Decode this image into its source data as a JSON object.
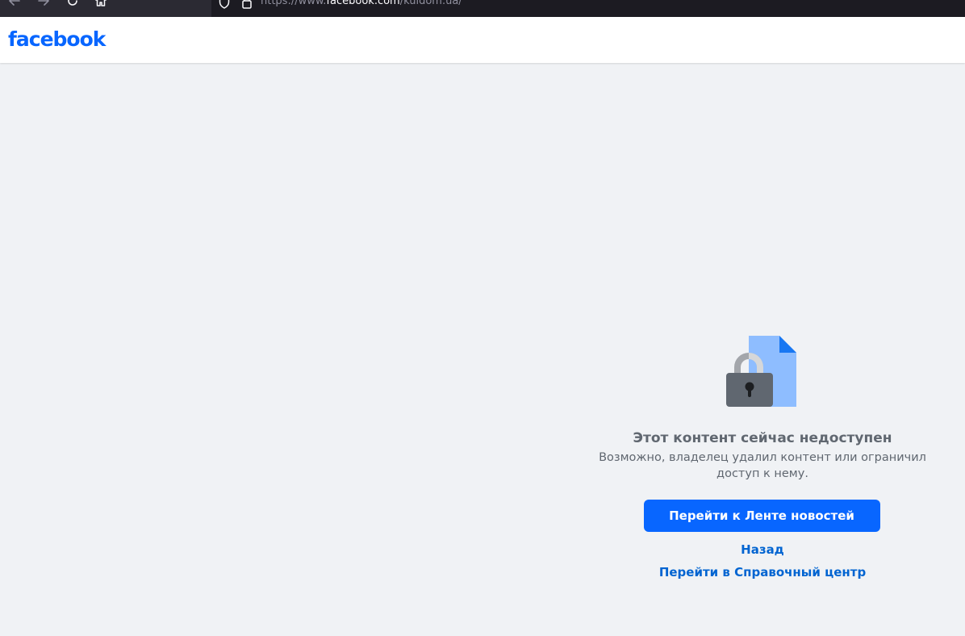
{
  "browser": {
    "url_prefix": "https://www.",
    "url_domain": "facebook.com",
    "url_path": "/kuldom.ua/"
  },
  "header": {
    "logo": "facebook",
    "brand_color": "#0866ff"
  },
  "content": {
    "title": "Этот контент сейчас недоступен",
    "subtitle": "Возможно, владелец удалил контент или ограничил доступ к нему.",
    "primary_button": "Перейти к Ленте новостей",
    "back_link": "Назад",
    "help_link": "Перейти в Справочный центр"
  },
  "icons": {
    "back": "arrow-left-icon",
    "forward": "arrow-right-icon",
    "reload": "reload-icon",
    "home": "home-icon",
    "shield": "shield-icon",
    "lock": "lock-icon",
    "illustration": "locked-document-icon"
  }
}
